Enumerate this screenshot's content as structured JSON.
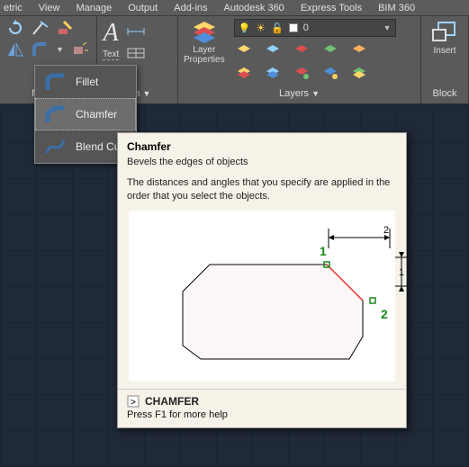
{
  "menubar": [
    "etric",
    "View",
    "Manage",
    "Output",
    "Add-ins",
    "Autodesk 360",
    "Express Tools",
    "BIM 360"
  ],
  "panels": {
    "modify": {
      "title": "Mo..."
    },
    "annot": {
      "title": "tion",
      "text_glyph": "A",
      "text_label": "Text"
    },
    "layers": {
      "title": "Layers",
      "prop_label": "Layer\nProperties",
      "combo_value": "0"
    },
    "block": {
      "title": "Block",
      "insert_label": "Insert"
    }
  },
  "flyout": {
    "items": [
      {
        "label": "Fillet",
        "icon": "fillet-icon"
      },
      {
        "label": "Chamfer",
        "icon": "chamfer-icon",
        "selected": true
      },
      {
        "label": "Blend Cur",
        "icon": "blend-icon"
      }
    ]
  },
  "tooltip": {
    "title": "Chamfer",
    "desc": "Bevels the edges of objects",
    "body": "The distances and angles that you specify are applied in the order that you select the objects.",
    "cmd": "CHAMFER",
    "help": "Press F1 for more help"
  },
  "chart_data": {
    "type": "diagram",
    "labels": {
      "p1": "1",
      "p2": "2",
      "d_h": "2",
      "d_v": "1"
    }
  }
}
